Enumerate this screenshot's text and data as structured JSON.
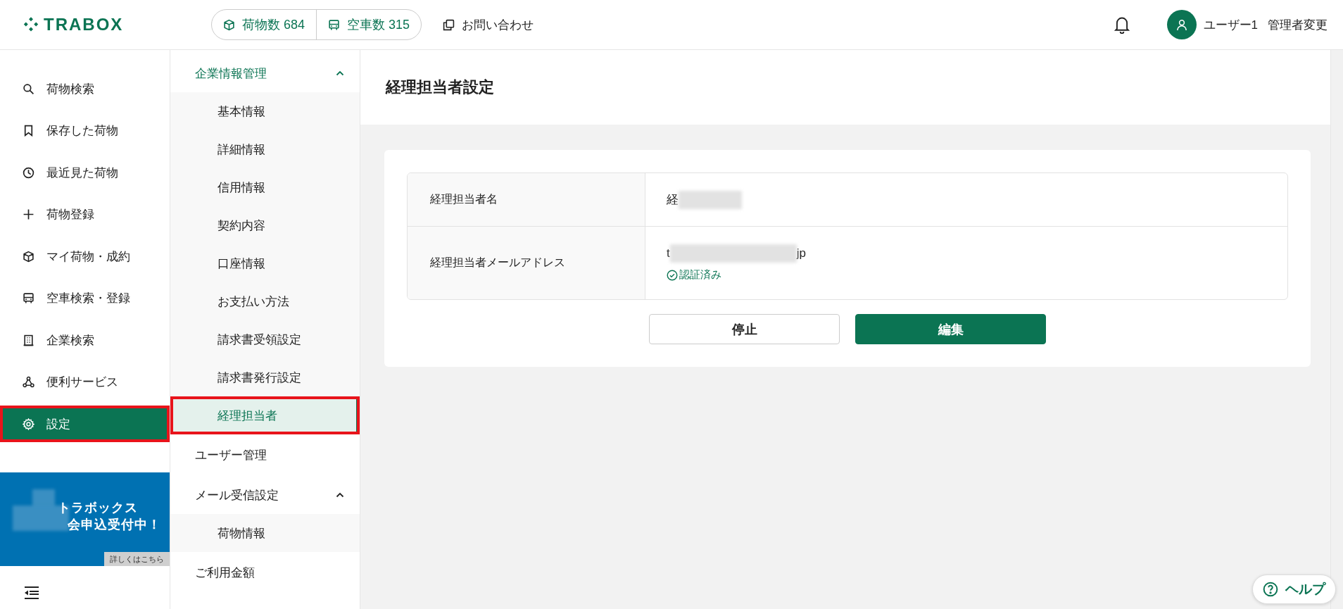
{
  "header": {
    "logo": "TRABOX",
    "stats": [
      {
        "kind": "cargo",
        "label": "荷物数 684"
      },
      {
        "kind": "vehicle",
        "label": "空車数 315"
      }
    ],
    "contact": "お問い合わせ",
    "user": "ユーザー1",
    "admin_link": "管理者変更"
  },
  "sidebar": {
    "items": [
      {
        "kind": "search",
        "label": "荷物検索",
        "selected": false,
        "highlighted": false
      },
      {
        "kind": "bookmark",
        "label": "保存した荷物",
        "selected": false,
        "highlighted": false
      },
      {
        "kind": "clock",
        "label": "最近見た荷物",
        "selected": false,
        "highlighted": false
      },
      {
        "kind": "plus",
        "label": "荷物登録",
        "selected": false,
        "highlighted": false
      },
      {
        "kind": "box",
        "label": "マイ荷物・成約",
        "selected": false,
        "highlighted": false
      },
      {
        "kind": "vehicle",
        "label": "空車検索・登録",
        "selected": false,
        "highlighted": false
      },
      {
        "kind": "building",
        "label": "企業検索",
        "selected": false,
        "highlighted": false
      },
      {
        "kind": "nodes",
        "label": "便利サービス",
        "selected": false,
        "highlighted": false
      },
      {
        "kind": "gear",
        "label": "設定",
        "selected": true,
        "highlighted": true
      }
    ],
    "banner": {
      "lines": [
        "トラボックス",
        "会申込受付中！"
      ],
      "link": "詳しくはこちら"
    }
  },
  "submenu": {
    "items": [
      {
        "label": "企業情報管理",
        "expanded": true,
        "children": [
          {
            "label": "基本情報",
            "selected": false,
            "highlighted": false
          },
          {
            "label": "詳細情報",
            "selected": false,
            "highlighted": false
          },
          {
            "label": "信用情報",
            "selected": false,
            "highlighted": false
          },
          {
            "label": "契約内容",
            "selected": false,
            "highlighted": false
          },
          {
            "label": "口座情報",
            "selected": false,
            "highlighted": false
          },
          {
            "label": "お支払い方法",
            "selected": false,
            "highlighted": false
          },
          {
            "label": "請求書受領設定",
            "selected": false,
            "highlighted": false
          },
          {
            "label": "請求書発行設定",
            "selected": false,
            "highlighted": false
          },
          {
            "label": "経理担当者",
            "selected": true,
            "highlighted": true
          }
        ]
      },
      {
        "label": "ユーザー管理",
        "selected": false
      },
      {
        "label": "メール受信設定",
        "expanded": true,
        "children": [
          {
            "label": "荷物情報",
            "selected": false,
            "highlighted": false
          }
        ]
      },
      {
        "label": "ご利用金額",
        "selected": false
      }
    ]
  },
  "main": {
    "title": "経理担当者設定",
    "rows": [
      {
        "label": "経理担当者名",
        "value": [
          {
            "kind": "text",
            "text": "経"
          },
          {
            "kind": "redacted"
          }
        ]
      },
      {
        "label": "経理担当者メールアドレス",
        "value": [
          {
            "kind": "text",
            "text": "t"
          },
          {
            "kind": "redacted"
          },
          {
            "kind": "text",
            "text": "jp"
          }
        ],
        "verified": true,
        "verified_label": "認証済み"
      }
    ],
    "buttons": [
      {
        "kind": "secondary",
        "label": "停止"
      },
      {
        "kind": "primary",
        "label": "編集"
      }
    ]
  },
  "help": "ヘルプ"
}
